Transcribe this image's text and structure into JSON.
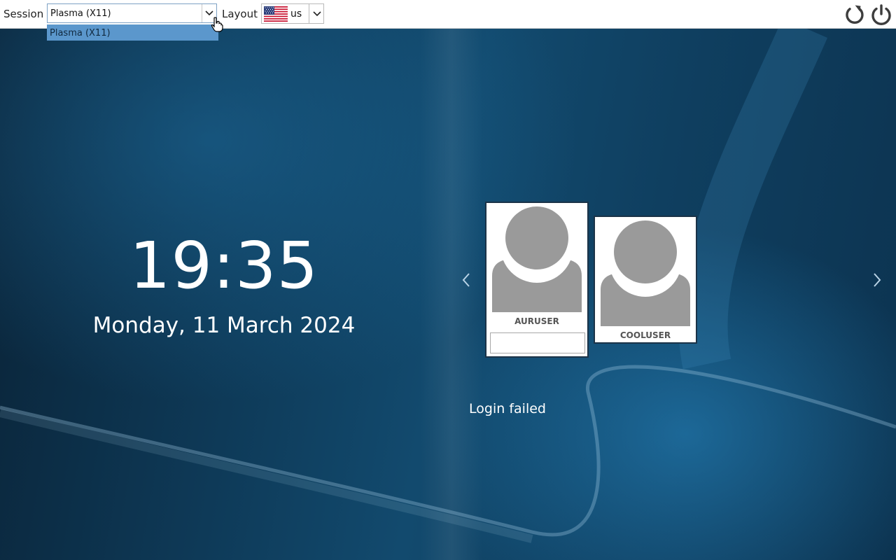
{
  "topbar": {
    "session_label": "Session",
    "session_value": "Plasma (X11)",
    "session_options": [
      "Plasma (X11)"
    ],
    "layout_label": "Layout",
    "layout_value": "us",
    "layout_flag": "us-flag-icon",
    "reboot_icon": "reboot-icon",
    "power_icon": "power-icon"
  },
  "clock": {
    "time": "19:35",
    "date": "Monday, 11 March 2024"
  },
  "users": [
    {
      "name": "AURUSER",
      "selected": true,
      "password_placeholder": ""
    },
    {
      "name": "COOLUSER",
      "selected": false
    }
  ],
  "status": {
    "message": "Login failed"
  },
  "colors": {
    "dropdown_highlight": "#5b97cc",
    "background_dark": "#0a2337",
    "background_mid": "#124a6e",
    "card_border": "#1b3348",
    "avatar_gray": "#9a9a9a"
  }
}
